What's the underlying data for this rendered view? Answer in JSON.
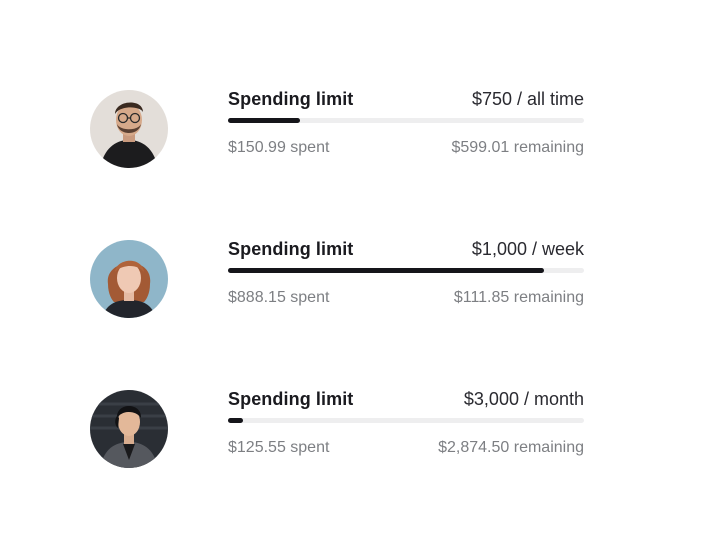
{
  "cards": [
    {
      "title": "Spending limit",
      "limit": "$750 / all time",
      "spent": "$150.99 spent",
      "remaining": "$599.01 remaining",
      "progress_fraction": 0.2013,
      "avatar": "person-man-glasses-avatar"
    },
    {
      "title": "Spending limit",
      "limit": "$1,000 / week",
      "spent": "$888.15 spent",
      "remaining": "$111.85 remaining",
      "progress_fraction": 0.8882,
      "avatar": "person-woman-red-hair-avatar"
    },
    {
      "title": "Spending limit",
      "limit": "$3,000 / month",
      "spent": "$125.55 spent",
      "remaining": "$2,874.50 remaining",
      "progress_fraction": 0.0419,
      "avatar": "person-woman-dark-hair-avatar"
    }
  ],
  "colors": {
    "bar_fill": "#15151a",
    "bar_track": "#eeeeef",
    "secondary_text": "#7d7f83"
  }
}
